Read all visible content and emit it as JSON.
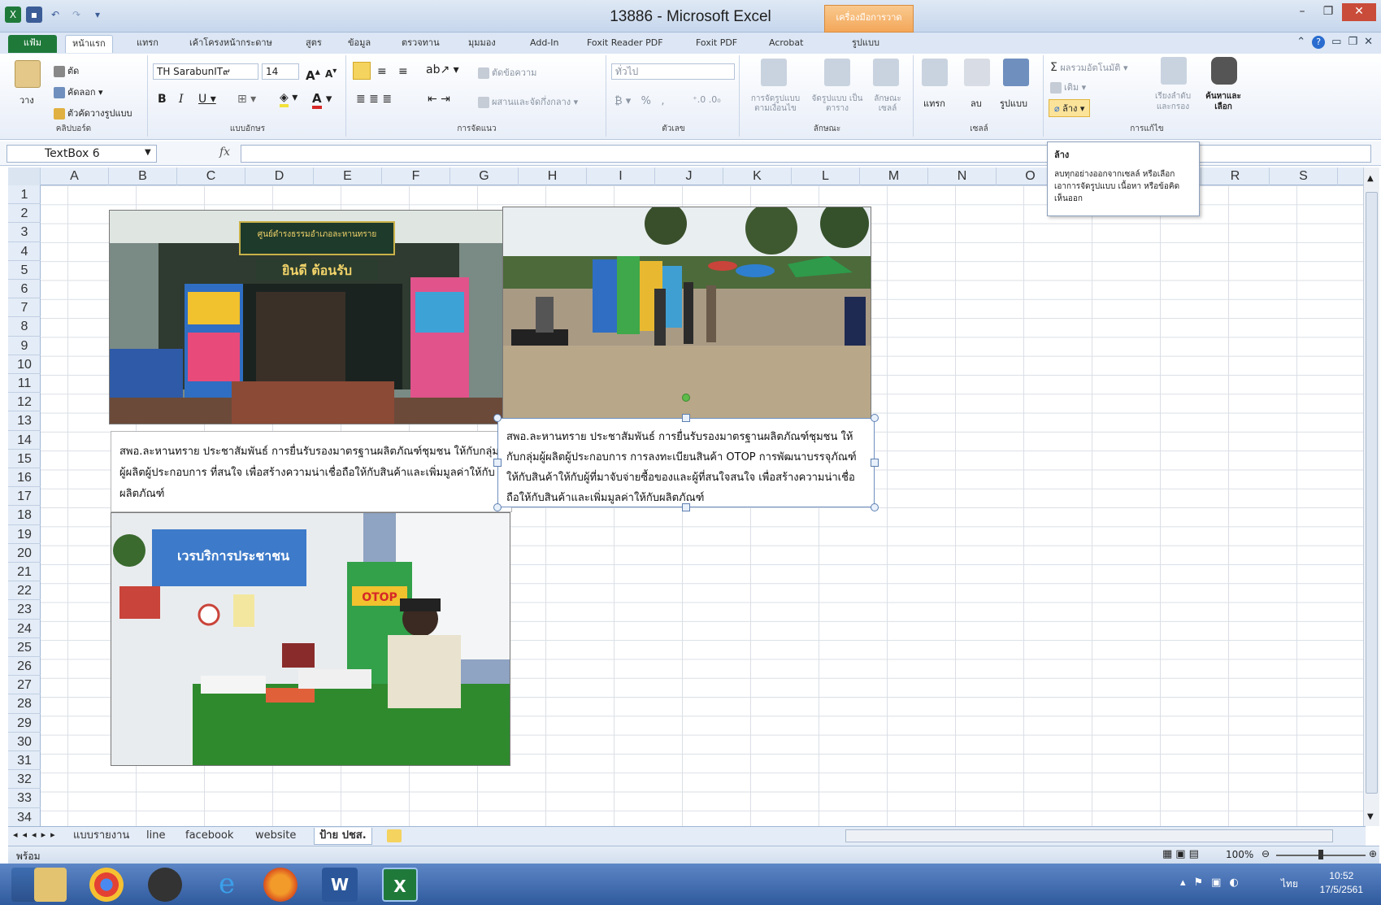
{
  "window": {
    "title": "13886 - Microsoft Excel",
    "contextual_tab": "เครื่องมือการวาด",
    "controls": [
      "–",
      "❐",
      "✕"
    ]
  },
  "tabs": [
    {
      "label": "แฟ้ม",
      "kind": "file"
    },
    {
      "label": "หน้าแรก",
      "active": true
    },
    {
      "label": "แทรก"
    },
    {
      "label": "เค้าโครงหน้ากระดาษ"
    },
    {
      "label": "สูตร"
    },
    {
      "label": "ข้อมูล"
    },
    {
      "label": "ตรวจทาน"
    },
    {
      "label": "มุมมอง"
    },
    {
      "label": "Add-In"
    },
    {
      "label": "Foxit Reader PDF"
    },
    {
      "label": "Foxit PDF"
    },
    {
      "label": "Acrobat"
    },
    {
      "label": "รูปแบบ"
    }
  ],
  "ribbon": {
    "clipboard": {
      "cut": "ตัด",
      "copy": "คัดลอก",
      "paste": "วาง",
      "format_painter": "ตัวคัดวางรูปแบบ",
      "label": "คลิปบอร์ด"
    },
    "font": {
      "name": "TH SarabunIT๙",
      "size": "14",
      "label": "แบบอักษร"
    },
    "alignment": {
      "wrap": "ตัดข้อความ",
      "merge": "ผสานและจัดกึ่งกลาง",
      "label": "การจัดแนว"
    },
    "number": {
      "format": "ทั่วไป",
      "label": "ตัวเลข"
    },
    "styles": {
      "conditional": "การจัดรูปแบบ ตามเงื่อนไข",
      "table": "จัดรูปแบบ เป็นตาราง",
      "cell": "ลักษณะ เซลล์",
      "label": "ลักษณะ"
    },
    "cells": {
      "insert": "แทรก",
      "delete": "ลบ",
      "format": "รูปแบบ",
      "label": "เซลล์"
    },
    "editing": {
      "autosum": "ผลรวมอัตโนมัติ",
      "fill": "เติม",
      "clear": "ล้าง",
      "sort": "เรียงลำดับ และกรอง",
      "find": "ค้นหาและ เลือก",
      "label": "การแก้ไข"
    }
  },
  "formula_bar": {
    "name_box": "TextBox 6",
    "fx": "fx",
    "value": ""
  },
  "tooltip": {
    "title": "ล้าง",
    "body": "ลบทุกอย่างออกจากเซลล์ หรือเลือกเอาการจัดรูปแบบ เนื้อหา หรือข้อคิดเห็นออก"
  },
  "columns": [
    "A",
    "B",
    "C",
    "D",
    "E",
    "F",
    "G",
    "H",
    "I",
    "J",
    "K",
    "L",
    "M",
    "N",
    "O",
    "P",
    "Q",
    "R",
    "S"
  ],
  "rows": [
    "1",
    "2",
    "3",
    "4",
    "5",
    "6",
    "7",
    "8",
    "9",
    "10",
    "11",
    "12",
    "13",
    "14",
    "15",
    "16",
    "17",
    "18",
    "19",
    "20",
    "21",
    "22",
    "23",
    "24",
    "25",
    "26",
    "27",
    "28",
    "29",
    "30",
    "31",
    "32",
    "33",
    "34"
  ],
  "textboxes": [
    {
      "text": "สพอ.ละหานทราย ประชาสัมพันธ์ การยื่นรับรองมาตรฐานผลิตภัณฑ์ชุมชน ให้กับกลุ่มผู้ผลิตผู้ประกอบการ ที่สนใจ เพื่อสร้างความน่าเชื่อถือให้กับสินค้าและเพิ่มมูลค่าให้กับผลิตภัณฑ์"
    },
    {
      "text": "สพอ.ละหานทราย ประชาสัมพันธ์ การยื่นรับรองมาตรฐานผลิตภัณฑ์ชุมชน ให้กับกลุ่มผู้ผลิตผู้ประกอบการ การลงทะเบียนสินค้า OTOP การพัฒนาบรรจุภัณฑ์ให้กับสินค้าให้กับผู้ที่มาจับจ่ายซื้อของและผู้ที่สนใจสนใจ เพื่อสร้างความน่าเชื่อถือให้กับสินค้าและเพิ่มมูลค่าให้กับผลิตภัณฑ์",
      "selected": true
    }
  ],
  "photos": {
    "p1": {
      "sign1": "ศูนย์ดำรงธรรมอำเภอละหานทราย",
      "sign2": "ยินดี ต้อนรับ"
    },
    "p3": {
      "banner": "เวรบริการประชาชน",
      "poster": "OTOP"
    }
  },
  "sheets": [
    {
      "label": "แบบรายงาน"
    },
    {
      "label": "line"
    },
    {
      "label": "facebook"
    },
    {
      "label": "website"
    },
    {
      "label": "ป้าย ปชส.",
      "active": true
    }
  ],
  "status": {
    "ready": "พร้อม",
    "zoom": "100%"
  },
  "taskbar": {
    "lang": "ไทย",
    "time": "10:52",
    "date": "17/5/2561"
  },
  "colors": {
    "excel_green": "#1f7a3a",
    "ribbon_bg": "#e8eef8",
    "taskbar": "#2f5a9d",
    "contextual": "#f3a75a"
  }
}
